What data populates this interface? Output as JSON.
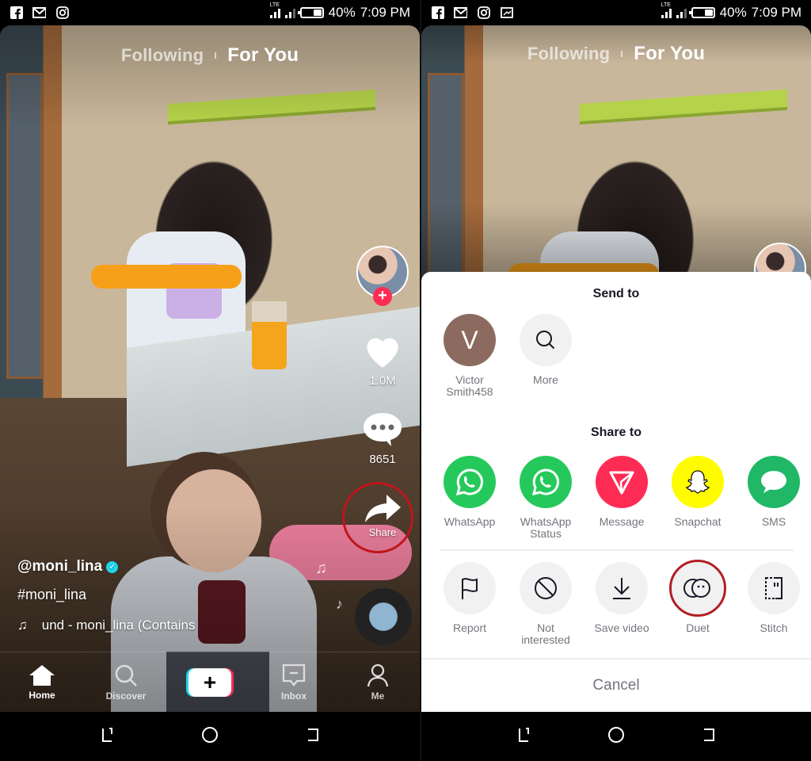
{
  "status_bar": {
    "left_icons": [
      "facebook-icon",
      "gmail-icon",
      "instagram-icon"
    ],
    "right_extra_icons_right_screen": [
      "screen-cast-icon"
    ],
    "network": "LTE",
    "battery": "40%",
    "battery_level": 0.4,
    "time": "7:09 PM"
  },
  "feed": {
    "tabs": [
      {
        "label": "Following",
        "active": false
      },
      {
        "label": "For You",
        "active": true
      }
    ],
    "likes": "1.0M",
    "comments": "8651",
    "share_label": "Share",
    "username": "@moni_lina",
    "hashtag": "#moni_lina",
    "sound": "und - moni_lina (Contains"
  },
  "bottom_nav": [
    {
      "label": "Home",
      "icon": "home-icon",
      "active": true
    },
    {
      "label": "Discover",
      "icon": "search-icon",
      "active": false
    },
    {
      "label": "",
      "icon": "plus-icon",
      "active": false
    },
    {
      "label": "Inbox",
      "icon": "inbox-icon",
      "active": false
    },
    {
      "label": "Me",
      "icon": "profile-icon",
      "active": false
    }
  ],
  "share_sheet": {
    "send_to_title": "Send to",
    "contacts": [
      {
        "label": "Victor Smith458",
        "line1": "Victor",
        "line2": "Smith458",
        "initial": "V",
        "color": "#8d6a5f"
      },
      {
        "label": "More",
        "line1": "More",
        "line2": "",
        "icon": "search-icon"
      }
    ],
    "share_to_title": "Share to",
    "apps": [
      {
        "line1": "WhatsApp",
        "line2": "",
        "color": "#25c95b",
        "icon": "whatsapp-icon"
      },
      {
        "line1": "WhatsApp",
        "line2": "Status",
        "color": "#25c95b",
        "icon": "whatsapp-status-icon"
      },
      {
        "line1": "Message",
        "line2": "",
        "color": "#fe2c55",
        "icon": "message-icon"
      },
      {
        "line1": "Snapchat",
        "line2": "",
        "color": "#fffc00",
        "icon": "snapchat-icon"
      },
      {
        "line1": "SMS",
        "line2": "",
        "color": "#20b866",
        "icon": "sms-icon"
      }
    ],
    "actions": [
      {
        "line1": "Report",
        "line2": "",
        "icon": "flag-icon"
      },
      {
        "line1": "Not",
        "line2": "interested",
        "icon": "not-interested-icon"
      },
      {
        "line1": "Save video",
        "line2": "",
        "icon": "download-icon"
      },
      {
        "line1": "Duet",
        "line2": "",
        "icon": "duet-icon",
        "highlighted": true
      },
      {
        "line1": "Stitch",
        "line2": "",
        "icon": "stitch-icon"
      }
    ],
    "cancel_label": "Cancel"
  },
  "colors": {
    "accent": "#fe2c55",
    "accent_cyan": "#20d5ec",
    "highlight_circle": "#c0151c"
  }
}
